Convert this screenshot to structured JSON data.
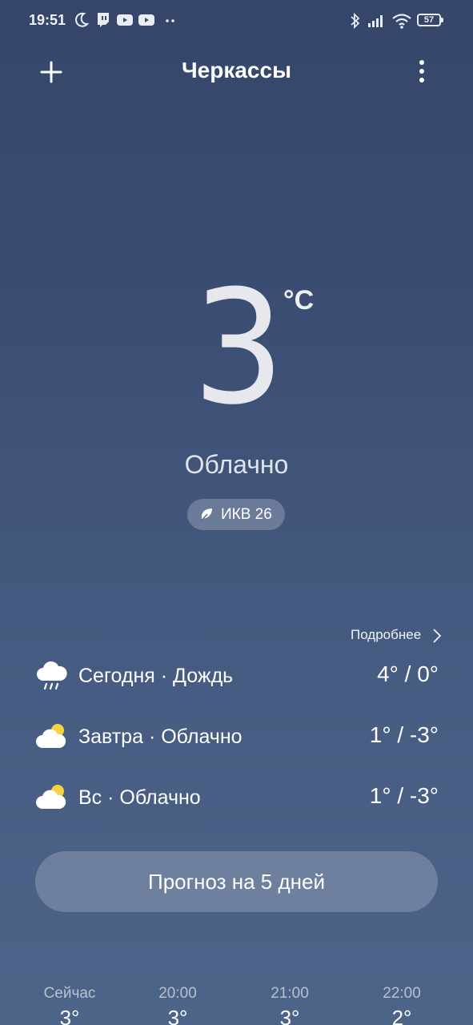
{
  "status_bar": {
    "time": "19:51",
    "battery": "57",
    "icons": [
      "moon-icon",
      "twitch-icon",
      "youtube-icon",
      "youtube-icon",
      "more-dots-icon",
      "bluetooth-icon",
      "signal-icon",
      "wifi-icon",
      "battery-icon"
    ]
  },
  "header": {
    "city": "Черкассы",
    "add_icon": "plus-icon",
    "menu_icon": "more-vertical-icon"
  },
  "current": {
    "temperature": "3",
    "unit": "°C",
    "condition": "Облачно",
    "aqi_label": "ИКВ 26"
  },
  "forecast": {
    "more_label": "Подробнее",
    "days": [
      {
        "label": "Сегодня · Дождь",
        "temp": "4° / 0°",
        "icon": "rain-cloud-icon"
      },
      {
        "label": "Завтра · Облачно",
        "temp": "1° / -3°",
        "icon": "partly-cloudy-icon"
      },
      {
        "label": "Вс · Облачно",
        "temp": "1° / -3°",
        "icon": "partly-cloudy-icon"
      }
    ],
    "five_day_button": "Прогноз на 5 дней"
  },
  "hourly": [
    {
      "time": "Сейчас",
      "temp": "3°"
    },
    {
      "time": "20:00",
      "temp": "3°"
    },
    {
      "time": "21:00",
      "temp": "3°"
    },
    {
      "time": "22:00",
      "temp": "2°"
    }
  ]
}
